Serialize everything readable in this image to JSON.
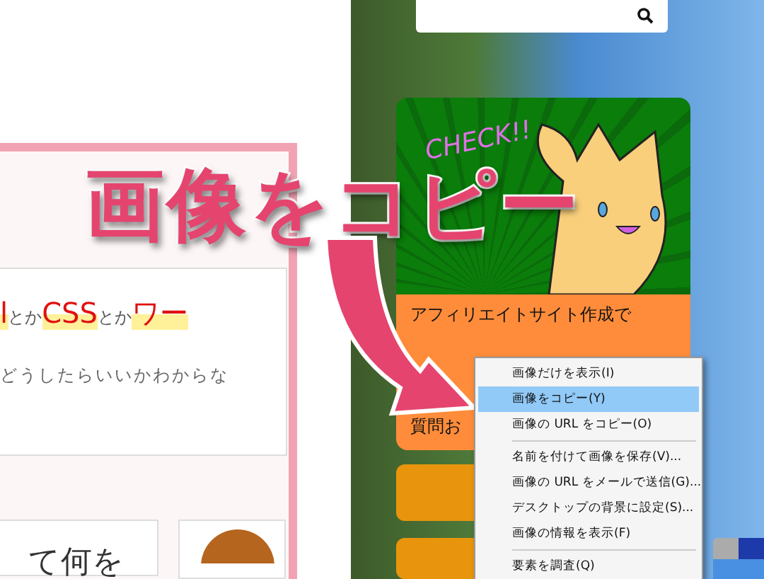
{
  "article": {
    "headline": [
      {
        "text": "l",
        "highlight": true
      },
      {
        "text": "とか",
        "highlight": false
      },
      {
        "text": "CSS",
        "highlight": true
      },
      {
        "text": "とか",
        "highlight": false
      },
      {
        "text": "ワー",
        "highlight": true
      }
    ],
    "body": "どうしたらいいかわからな",
    "bubble": "て何を"
  },
  "sidebar": {
    "banner": {
      "caption": "CHECK!!",
      "title": "アフィリエイトサイト作成で",
      "subtitle": "質問お"
    }
  },
  "annotation": {
    "text": "画像をコピー"
  },
  "context_menu": [
    {
      "kind": "item",
      "label": "画像だけを表示(I)",
      "selected": false
    },
    {
      "kind": "item",
      "label": "画像をコピー(Y)",
      "selected": true
    },
    {
      "kind": "item",
      "label": "画像の URL をコピー(O)",
      "selected": false
    },
    {
      "kind": "separator"
    },
    {
      "kind": "item",
      "label": "名前を付けて画像を保存(V)...",
      "selected": false
    },
    {
      "kind": "item",
      "label": "画像の URL をメールで送信(G)...",
      "selected": false
    },
    {
      "kind": "item",
      "label": "デスクトップの背景に設定(S)...",
      "selected": false
    },
    {
      "kind": "item",
      "label": "画像の情報を表示(F)",
      "selected": false
    },
    {
      "kind": "separator"
    },
    {
      "kind": "item",
      "label": "要素を調査(Q)",
      "selected": false
    }
  ]
}
